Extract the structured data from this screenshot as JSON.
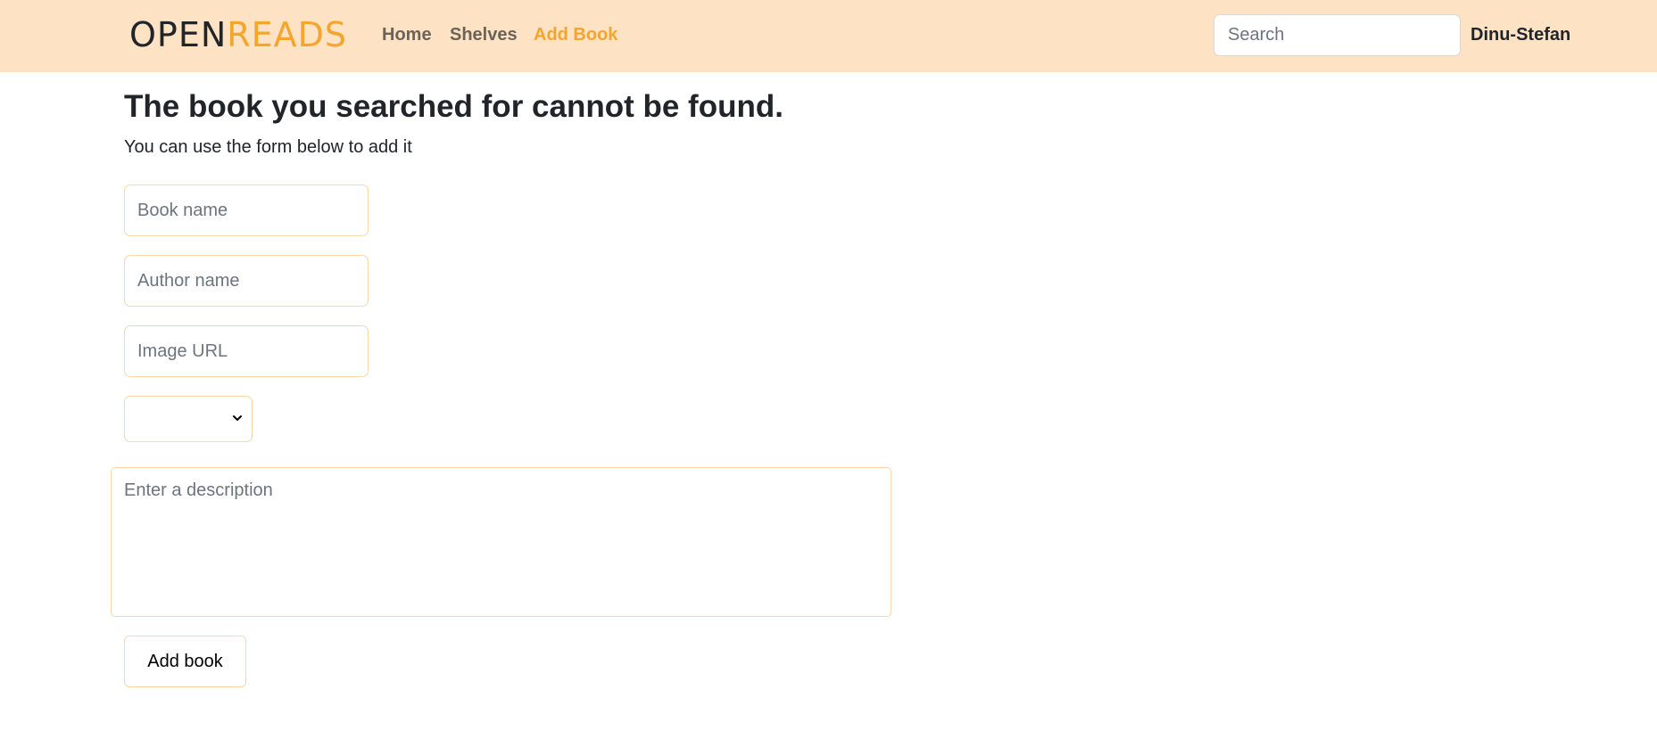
{
  "navbar": {
    "logo": {
      "part1": "OPEN",
      "part2": "READS"
    },
    "links": {
      "home": "Home",
      "shelves": "Shelves",
      "add_book": "Add Book"
    },
    "search": {
      "placeholder": "Search",
      "value": ""
    },
    "username": "Dinu-Stefan"
  },
  "colors": {
    "accent": "#f5a52c",
    "navbar_bg": "#fde2c4",
    "field_border": "#f8d7ab"
  },
  "main": {
    "title": "The book you searched for cannot be found.",
    "subtitle": "You can use the form below to add it",
    "form": {
      "book_name": {
        "placeholder": "Book name",
        "value": ""
      },
      "author_name": {
        "placeholder": "Author name",
        "value": ""
      },
      "image_url": {
        "placeholder": "Image URL",
        "value": ""
      },
      "category": {
        "selected": ""
      },
      "description": {
        "placeholder": "Enter a description",
        "value": ""
      },
      "submit_label": "Add book"
    }
  },
  "icons": {
    "select_arrow": "chevron-down-icon"
  }
}
